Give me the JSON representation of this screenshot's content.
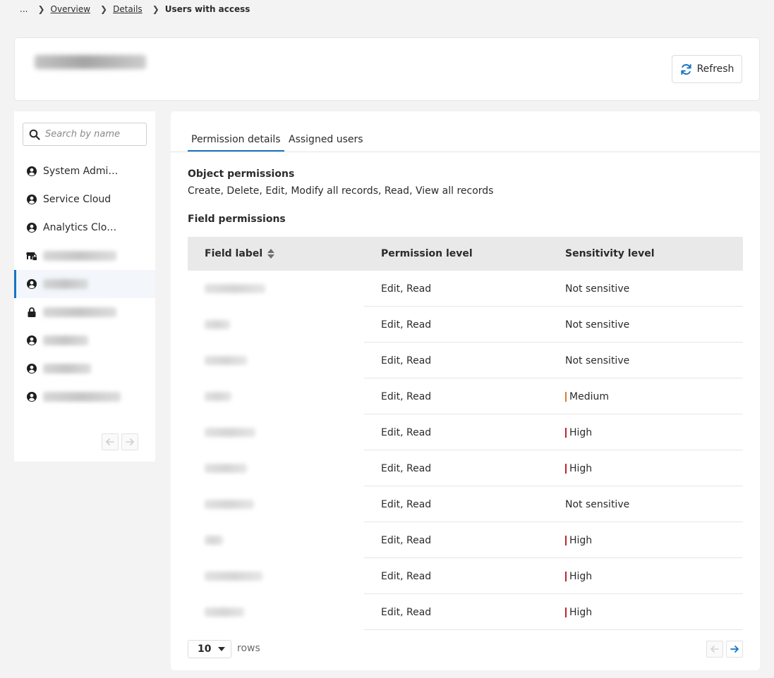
{
  "breadcrumb": {
    "ellipsis": "...",
    "items": [
      {
        "label": "Overview"
      },
      {
        "label": "Details"
      }
    ],
    "current": "Users with access"
  },
  "header": {
    "refresh_label": "Refresh"
  },
  "sidebar": {
    "search_placeholder": "Search by name",
    "items": [
      {
        "label": "System Admini...",
        "icon": "user-circle-icon"
      },
      {
        "label": "Service Cloud",
        "icon": "user-circle-icon"
      },
      {
        "label": "Analytics Cloud...",
        "icon": "user-circle-icon"
      },
      {
        "label": "",
        "icon": "store-lock-icon"
      },
      {
        "label": "",
        "icon": "user-circle-icon",
        "selected": true
      },
      {
        "label": "",
        "icon": "lock-icon"
      },
      {
        "label": "",
        "icon": "user-circle-icon"
      },
      {
        "label": "",
        "icon": "user-circle-icon"
      },
      {
        "label": "",
        "icon": "user-circle-icon"
      }
    ]
  },
  "tabs": [
    {
      "label": "Permission details",
      "active": true
    },
    {
      "label": "Assigned users",
      "active": false
    }
  ],
  "object_permissions": {
    "title": "Object permissions",
    "value": "Create, Delete, Edit, Modify all records, Read, View all records"
  },
  "field_permissions": {
    "title": "Field permissions",
    "columns": [
      "Field label",
      "Permission level",
      "Sensitivity level"
    ],
    "rows": [
      {
        "permission": "Edit, Read",
        "sensitivity": "Not sensitive"
      },
      {
        "permission": "Edit, Read",
        "sensitivity": "Not sensitive"
      },
      {
        "permission": "Edit, Read",
        "sensitivity": "Not sensitive"
      },
      {
        "permission": "Edit, Read",
        "sensitivity": "Medium"
      },
      {
        "permission": "Edit, Read",
        "sensitivity": "High"
      },
      {
        "permission": "Edit, Read",
        "sensitivity": "High"
      },
      {
        "permission": "Edit, Read",
        "sensitivity": "Not sensitive"
      },
      {
        "permission": "Edit, Read",
        "sensitivity": "High"
      },
      {
        "permission": "Edit, Read",
        "sensitivity": "High"
      },
      {
        "permission": "Edit, Read",
        "sensitivity": "High"
      }
    ]
  },
  "pagination": {
    "rows_value": "10",
    "rows_label": "rows"
  },
  "colors": {
    "accent": "#1774c2",
    "medium": "#e07b2d",
    "high": "#c2232b"
  }
}
